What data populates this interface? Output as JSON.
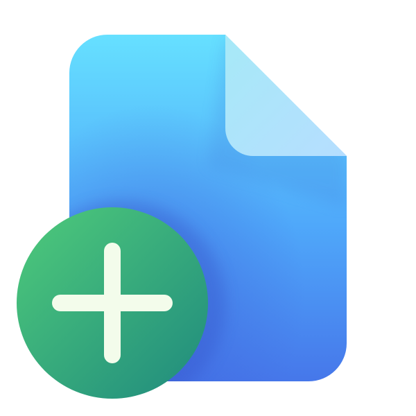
{
  "icon": {
    "name": "new-document-icon",
    "parts": {
      "document": "document-icon",
      "add_badge": "plus-icon"
    }
  },
  "colors": {
    "document_top": "#66E0FF",
    "document_mid": "#4FA8FA",
    "document_bottom": "#4677EA",
    "fold_light": "#A6E9F7",
    "fold_dark": "#B6DEFF",
    "badge_light": "#4FCB7A",
    "badge_dark": "#1F8A7E",
    "plus": "#F3FCEB",
    "background": "#FFFFFF"
  }
}
